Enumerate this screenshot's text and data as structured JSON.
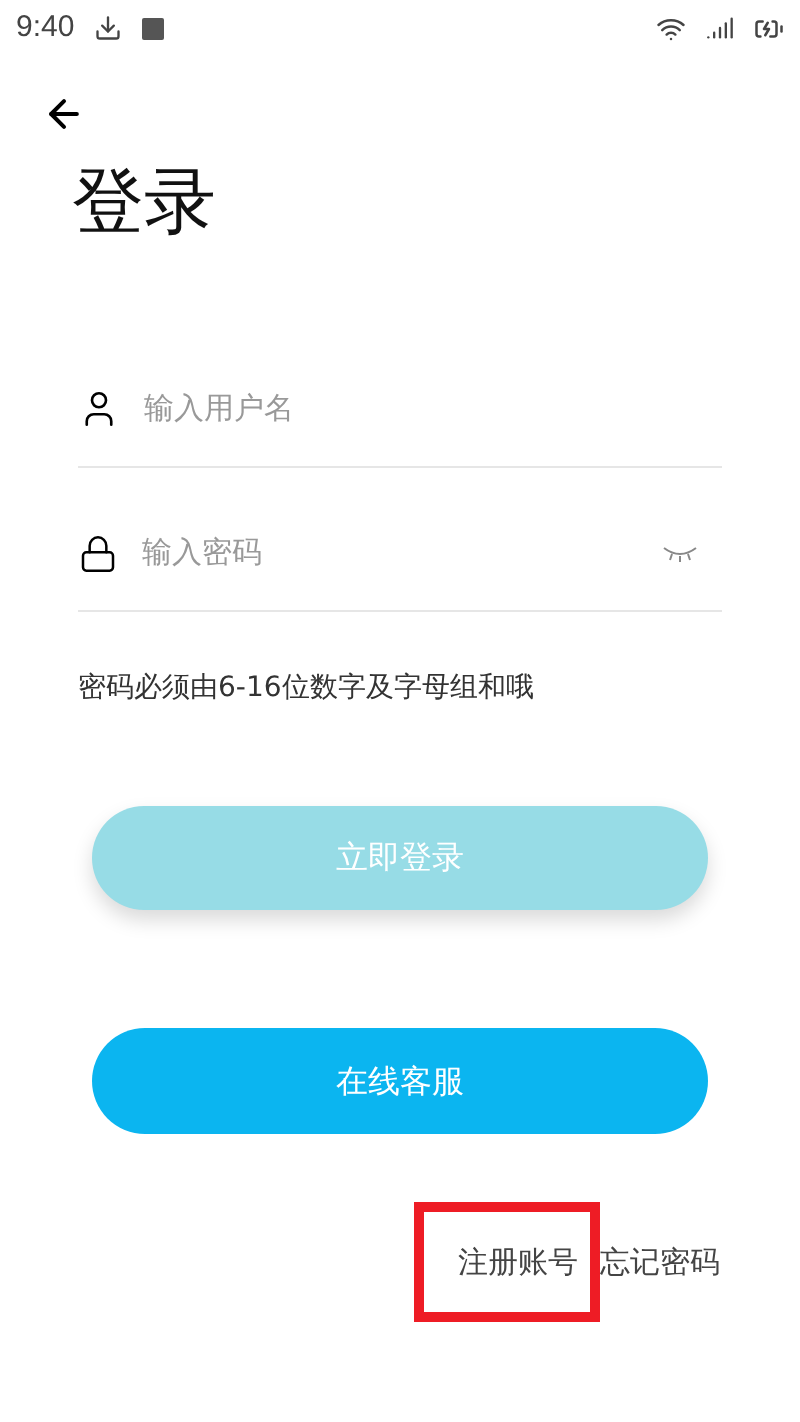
{
  "status_bar": {
    "time": "9:40"
  },
  "title": "登录",
  "fields": [
    {
      "kind": "user",
      "placeholder": "输入用户名"
    },
    {
      "kind": "password",
      "placeholder": "输入密码",
      "password_visible": false
    }
  ],
  "hint": "密码必须由6-16位数字及字母组和哦",
  "login_button": {
    "label": "立即登录",
    "disabled": true
  },
  "service_button": {
    "label": "在线客服"
  },
  "links": [
    {
      "label": "注册账号",
      "highlighted": true
    },
    {
      "label": "忘记密码",
      "highlighted": false
    }
  ]
}
